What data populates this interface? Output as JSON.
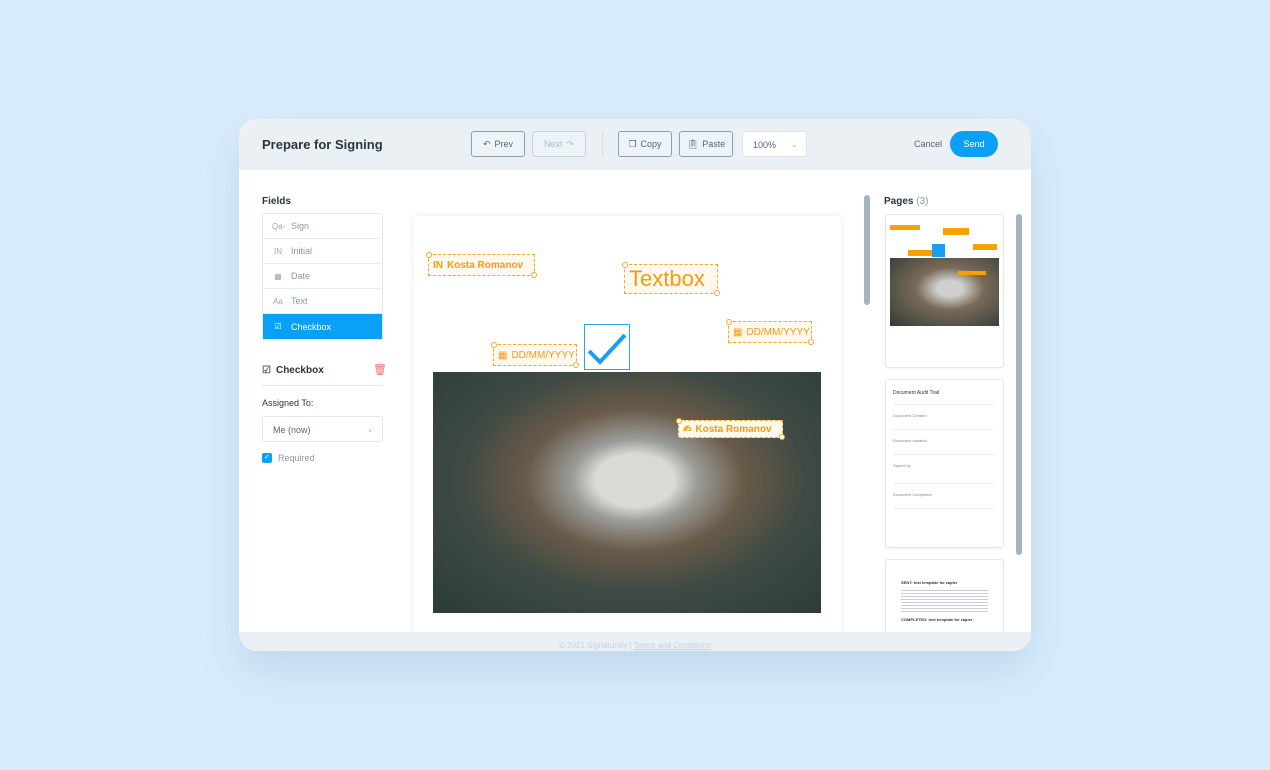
{
  "header": {
    "title": "Prepare for Signing",
    "prev": "Prev",
    "next": "Next",
    "copy": "Copy",
    "paste": "Paste",
    "zoom": "100%",
    "cancel": "Cancel",
    "send": "Send"
  },
  "fields": {
    "title": "Fields",
    "items": [
      {
        "icon": "sign-icon",
        "glyph": "Qa-",
        "label": "Sign"
      },
      {
        "icon": "initial-icon",
        "glyph": "IN",
        "label": "Initial"
      },
      {
        "icon": "calendar-icon",
        "glyph": "▦",
        "label": "Date"
      },
      {
        "icon": "text-icon",
        "glyph": "Aa",
        "label": "Text"
      },
      {
        "icon": "checkbox-icon",
        "glyph": "☑",
        "label": "Checkbox"
      }
    ],
    "active": "Checkbox"
  },
  "properties": {
    "title": "Checkbox",
    "assigned_label": "Assigned To:",
    "assigned_value": "Me (now)",
    "required_label": "Required",
    "required": true
  },
  "document": {
    "initial_field": "Kosta Romanov",
    "textbox": "Textbox",
    "date1": "DD/MM/YYYY",
    "date2": "DD/MM/YYYY",
    "sign_field": "Kosta Romanov",
    "checkbox_checked": true
  },
  "pages": {
    "title": "Pages",
    "count": "(3)",
    "audit_title": "Document Audit Trail",
    "audit": [
      "Document Created",
      "Document updated",
      "Signed by",
      "Document Completed"
    ],
    "p3_h1": "SENT: test template for zapier",
    "p3_h2": "COMPLETED: test template for zapier"
  },
  "footer": {
    "copyright": "© 2021 Signaturely |",
    "terms": "Terms and Conditions"
  },
  "colors": {
    "accent": "#0aa0f5",
    "field": "#f39c12",
    "delete": "#f26d6d"
  }
}
